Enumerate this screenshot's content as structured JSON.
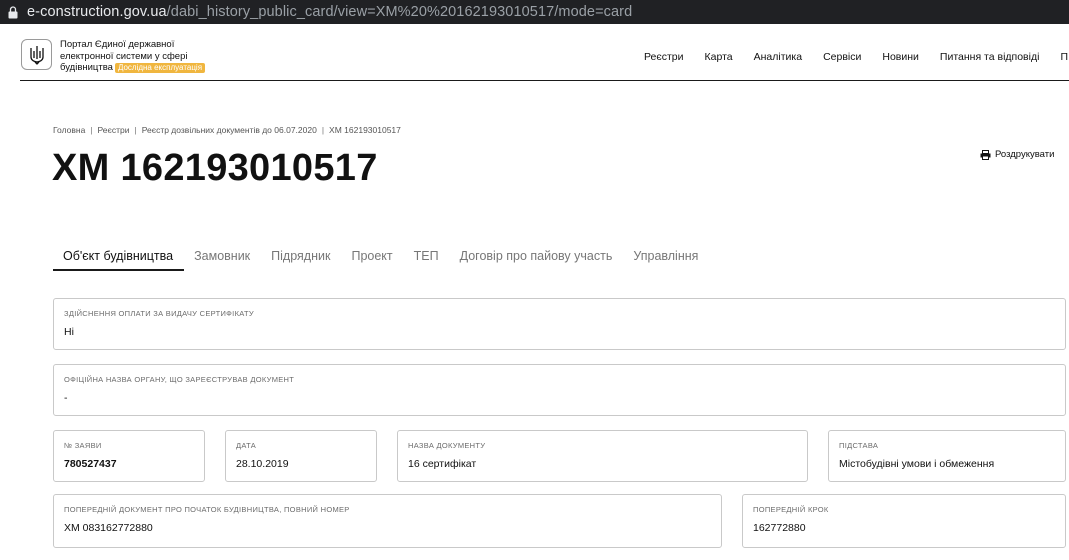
{
  "browser": {
    "url_host": "e-construction.gov.ua",
    "url_path": "/dabi_history_public_card/view=XM%20%20162193010517/mode=card"
  },
  "header": {
    "portal_title": "Портал Єдиної державної електронної системи у сфері будівництва",
    "beta_badge": "Дослідна експлуатація",
    "nav": [
      "Реєстри",
      "Карта",
      "Аналітика",
      "Сервіси",
      "Новини",
      "Питання та відповіді",
      "П"
    ]
  },
  "breadcrumb": [
    "Головна",
    "Реєстри",
    "Реєстр дозвільних документів до 06.07.2020",
    "ХМ 162193010517"
  ],
  "page": {
    "title": "ХМ 162193010517",
    "print_label": "Роздрукувати"
  },
  "tabs": [
    "Об'єкт будівництва",
    "Замовник",
    "Підрядник",
    "Проект",
    "ТЕП",
    "Договір про пайову участь",
    "Управління"
  ],
  "fields": {
    "payment": {
      "label": "Здійснення оплати за видачу сертифікату",
      "value": "Ні"
    },
    "org_name": {
      "label": "Офіційна назва органу, що зареєстрував документ",
      "value": "-"
    },
    "app_no": {
      "label": "№ заяви",
      "value": "780527437"
    },
    "date": {
      "label": "Дата",
      "value": "28.10.2019"
    },
    "doc_name": {
      "label": "Назва документу",
      "value": "16 сертифікат"
    },
    "basis": {
      "label": "Підстава",
      "value": "Містобудівні умови і обмеження"
    },
    "prev_doc": {
      "label": "Попередній документ про початок будівництва, повний номер",
      "value": "ХМ 083162772880"
    },
    "prev_step": {
      "label": "Попередній крок",
      "value": "162772880"
    }
  }
}
